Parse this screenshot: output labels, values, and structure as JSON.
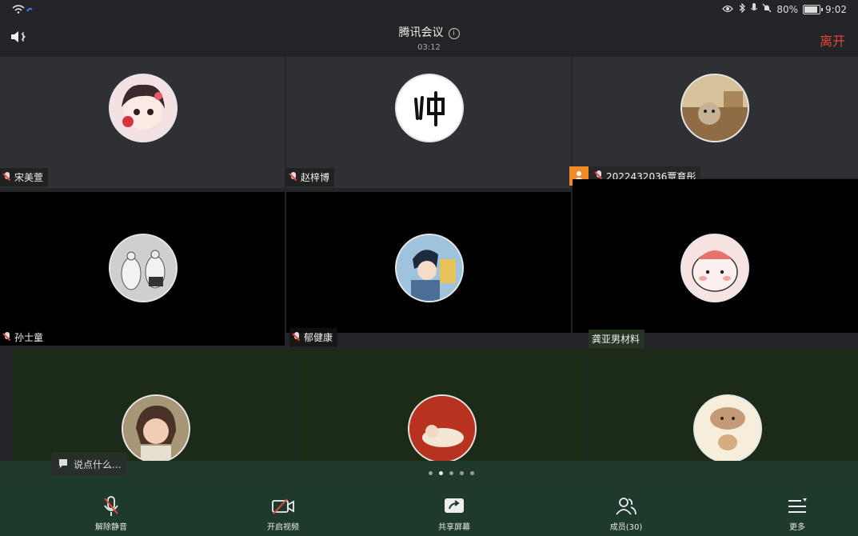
{
  "statusbar": {
    "battery": "80%",
    "time": "9:02"
  },
  "header": {
    "title": "腾讯会议",
    "timer": "03:12",
    "leave_label": "离开"
  },
  "participants": [
    {
      "name": "宋美萱"
    },
    {
      "name": "赵梓博"
    },
    {
      "name": "2022432036覃育彤"
    },
    {
      "name": "孙士童"
    },
    {
      "name": "郁健康"
    },
    {
      "name": "龚亚男材料"
    }
  ],
  "toast": {
    "text": "说点什么..."
  },
  "pagination": {
    "total": 5,
    "active": 2
  },
  "toolbar": {
    "unmute_label": "解除静音",
    "video_label": "开启视频",
    "share_label": "共享屏幕",
    "members_label": "成员(30)",
    "more_label": "更多"
  },
  "colors": {
    "accent_leave": "#e5463c",
    "toolbar_bg": "#1e3a2d",
    "badge_orange": "#f08a24"
  }
}
